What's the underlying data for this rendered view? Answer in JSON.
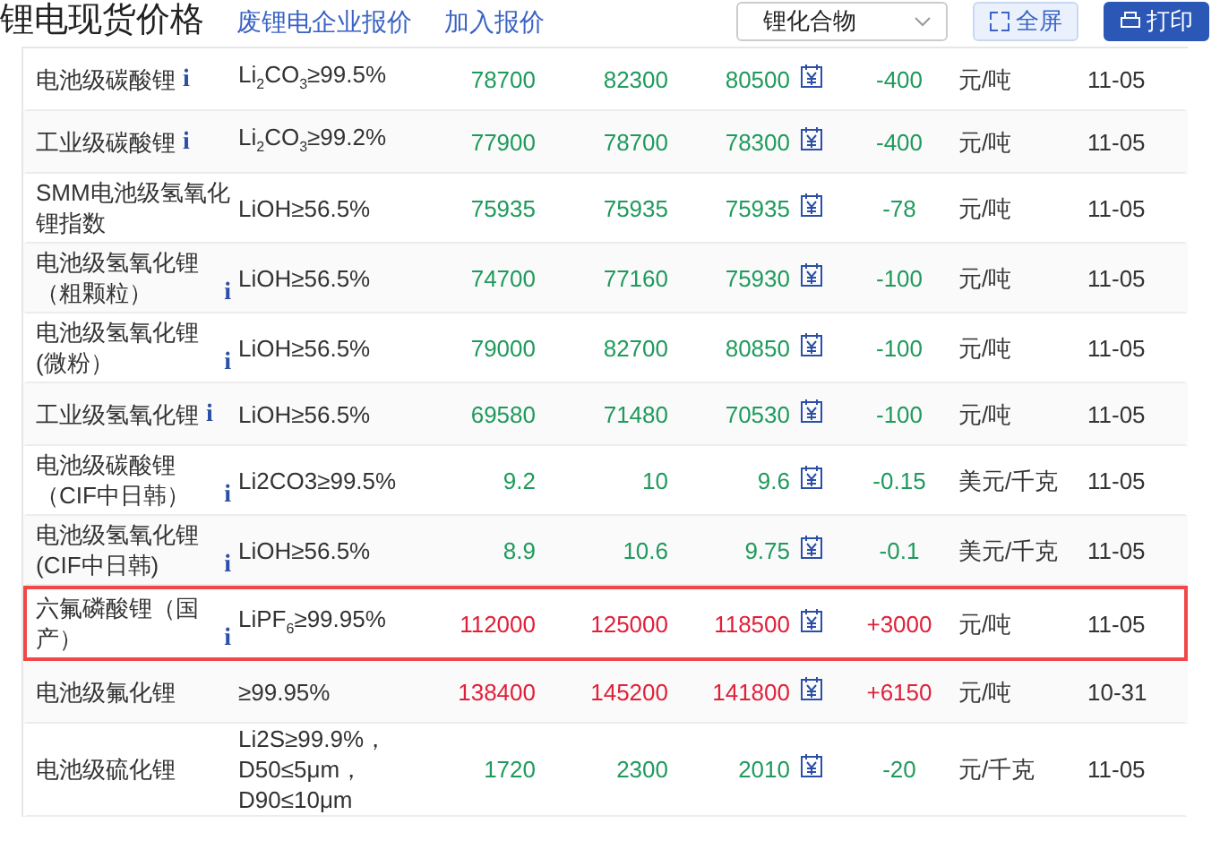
{
  "header": {
    "title": "锂电现货价格",
    "links": [
      "废锂电企业报价",
      "加入报价"
    ],
    "dropdown": {
      "value": "锂化合物"
    },
    "buttons": [
      {
        "kind": "fullscreen",
        "label": "全屏"
      },
      {
        "kind": "print",
        "label": "打印"
      }
    ]
  },
  "rows": [
    {
      "name": "电池级碳酸锂",
      "info": "i",
      "spec": "Li$_{2}$CO$_{3}$≥99.5%",
      "low": "78700",
      "high": "82300",
      "avg": "80500",
      "change": "-400",
      "unit": "元/吨",
      "date": "11-05",
      "rising": false,
      "highlighted": false
    },
    {
      "name": "工业级碳酸锂",
      "info": "i",
      "spec": "Li$_{2}$CO$_{3}$≥99.2%",
      "low": "77900",
      "high": "78700",
      "avg": "78300",
      "change": "-400",
      "unit": "元/吨",
      "date": "11-05",
      "rising": false,
      "highlighted": false
    },
    {
      "name": "SMM电池级氢氧化锂指数",
      "spec": "LiOH≥56.5%",
      "low": "75935",
      "high": "75935",
      "avg": "75935",
      "change": "-78",
      "unit": "元/吨",
      "date": "11-05",
      "rising": false,
      "highlighted": false
    },
    {
      "name": "电池级氢氧化锂（粗颗粒）",
      "info": "i",
      "spec": "LiOH≥56.5%",
      "low": "74700",
      "high": "77160",
      "avg": "75930",
      "change": "-100",
      "unit": "元/吨",
      "date": "11-05",
      "rising": false,
      "highlighted": false
    },
    {
      "name": "电池级氢氧化锂(微粉）",
      "info": "i",
      "spec": "LiOH≥56.5%",
      "low": "79000",
      "high": "82700",
      "avg": "80850",
      "change": "-100",
      "unit": "元/吨",
      "date": "11-05",
      "rising": false,
      "highlighted": false
    },
    {
      "name": "工业级氢氧化锂",
      "info": "i",
      "spec": "LiOH≥56.5%",
      "low": "69580",
      "high": "71480",
      "avg": "70530",
      "change": "-100",
      "unit": "元/吨",
      "date": "11-05",
      "rising": false,
      "highlighted": false
    },
    {
      "name": "电池级碳酸锂（CIF中日韩）",
      "info": "i",
      "spec": "Li2CO3≥99.5%",
      "low": "9.2",
      "high": "10",
      "avg": "9.6",
      "change": "-0.15",
      "unit": "美元/千克",
      "date": "11-05",
      "rising": false,
      "highlighted": false
    },
    {
      "name": "电池级氢氧化锂(CIF中日韩)",
      "info": "i",
      "spec": "LiOH≥56.5%",
      "low": "8.9",
      "high": "10.6",
      "avg": "9.75",
      "change": "-0.1",
      "unit": "美元/千克",
      "date": "11-05",
      "rising": false,
      "highlighted": false
    },
    {
      "name": "六氟磷酸锂（国产）",
      "info": "i",
      "spec": "LiPF$_{6}$≥99.95%",
      "low": "112000",
      "high": "125000",
      "avg": "118500",
      "change": "+3000",
      "unit": "元/吨",
      "date": "11-05",
      "rising": true,
      "highlighted": true
    },
    {
      "name": "电池级氟化锂",
      "spec": "≥99.95%",
      "low": "138400",
      "high": "145200",
      "avg": "141800",
      "change": "+6150",
      "unit": "元/吨",
      "date": "10-31",
      "rising": true,
      "highlighted": false
    },
    {
      "name": "电池级硫化锂",
      "spec": "Li2S≥99.9%，D50≤5μm，D90≤10μm",
      "low": "1720",
      "high": "2300",
      "avg": "2010",
      "change": "-20",
      "unit": "元/千克",
      "date": "11-05",
      "rising": false,
      "highlighted": false
    }
  ]
}
